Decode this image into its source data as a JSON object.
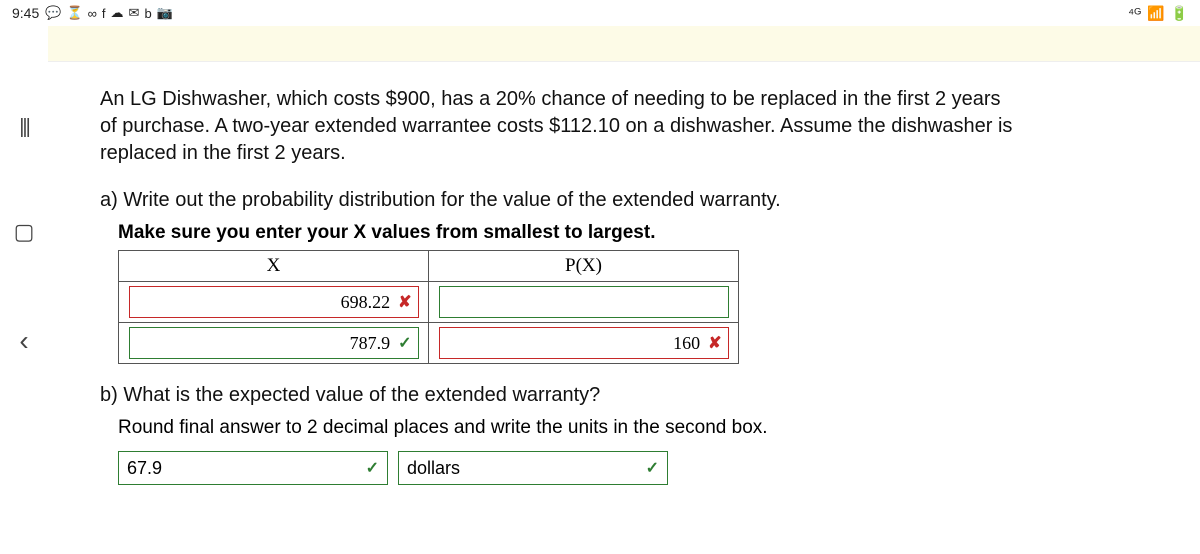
{
  "status": {
    "time": "9:45",
    "left_icons": [
      "💬",
      "⏳",
      "∞",
      "f",
      "☁",
      "✉",
      "b",
      "📷"
    ],
    "right_icons": [
      "⁴ᴳ",
      "📶",
      "🔋"
    ]
  },
  "nav": {
    "hamburger": "|||",
    "tab": "▢",
    "back": "‹"
  },
  "problem": {
    "text": "An LG Dishwasher, which costs $900, has a 20% chance of needing to be replaced in the first 2 years of purchase. A two-year extended warrantee costs $112.10 on a dishwasher. Assume the dishwasher is replaced in the first 2 years."
  },
  "part_a": {
    "label": "a) Write out the probability distribution for the value of the extended warranty.",
    "instruction": "Make sure you enter your X values from smallest to largest.",
    "headers": {
      "x": "X",
      "px": "P(X)"
    },
    "rows": [
      {
        "x_val": "698.22",
        "x_status": "wrong",
        "px_val": "",
        "px_status": "neutral"
      },
      {
        "x_val": "787.9",
        "x_status": "right",
        "px_val": "160",
        "px_status": "wrong"
      }
    ]
  },
  "part_b": {
    "label": "b) What is the expected value of the extended warranty?",
    "instruction": "Round final answer to 2 decimal places and write the units in the second box.",
    "value": "67.9",
    "units": "dollars"
  },
  "marks": {
    "wrong": "✘",
    "right": "✓"
  }
}
